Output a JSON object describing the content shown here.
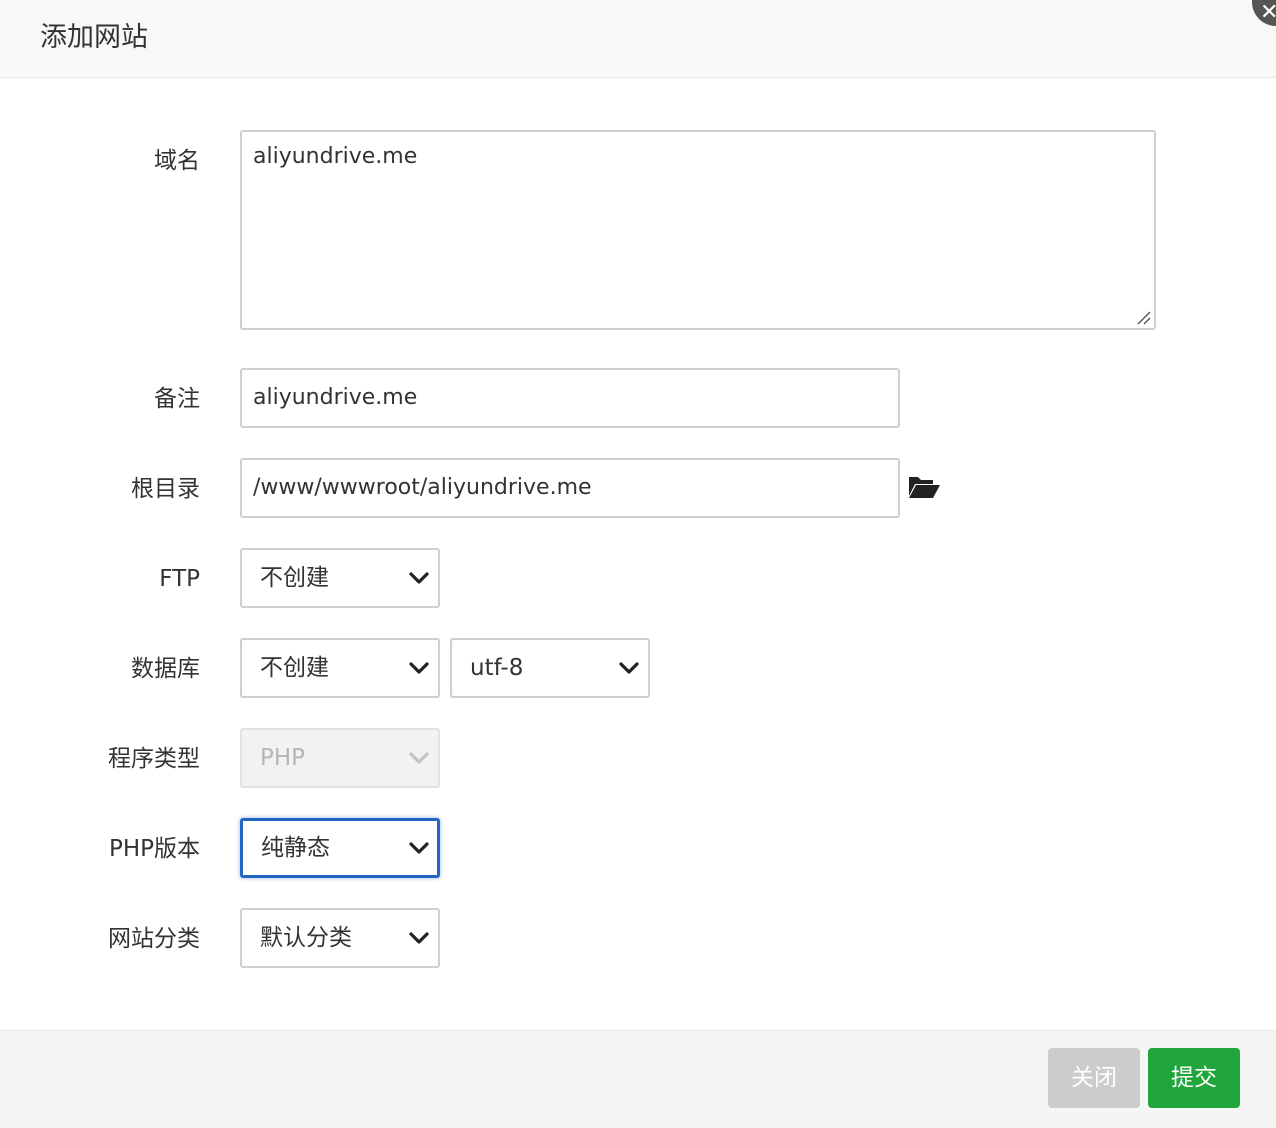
{
  "dialog": {
    "title": "添加网站"
  },
  "form": {
    "domain": {
      "label": "域名",
      "value": "aliyundrive.me"
    },
    "remark": {
      "label": "备注",
      "value": "aliyundrive.me"
    },
    "root_dir": {
      "label": "根目录",
      "value": "/www/wwwroot/aliyundrive.me",
      "icon": "folder-open-icon"
    },
    "ftp": {
      "label": "FTP",
      "selected": "不创建"
    },
    "database": {
      "label": "数据库",
      "selected": "不创建",
      "charset": "utf-8"
    },
    "program_type": {
      "label": "程序类型",
      "selected": "PHP",
      "disabled": true
    },
    "php_version": {
      "label": "PHP版本",
      "selected": "纯静态",
      "focused": true
    },
    "site_category": {
      "label": "网站分类",
      "selected": "默认分类"
    }
  },
  "footer": {
    "close_label": "关闭",
    "submit_label": "提交"
  },
  "colors": {
    "accent_green": "#20a53a",
    "focus_blue": "#2364c3",
    "disabled_button": "#cccccc"
  }
}
